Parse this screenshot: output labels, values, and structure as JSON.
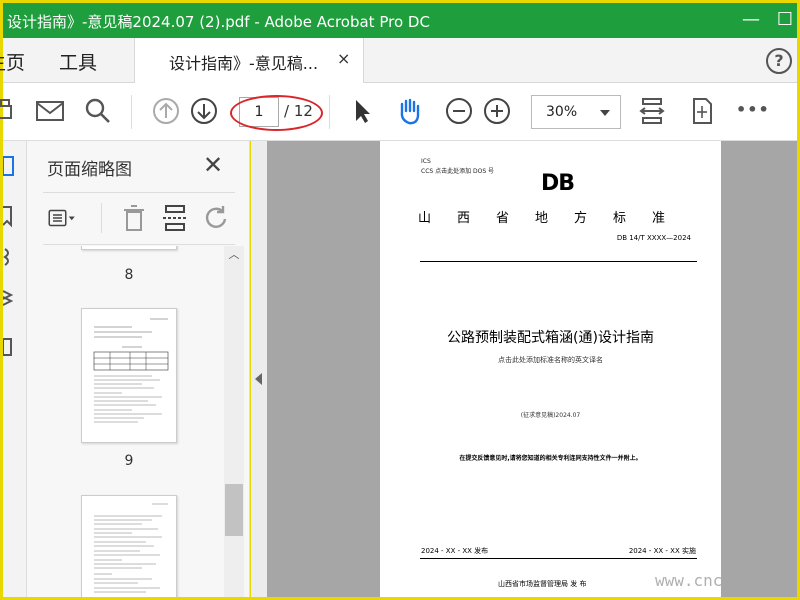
{
  "window": {
    "title": "设计指南》-意见稿2024.07 (2).pdf - Adobe Acrobat Pro DC",
    "title_bar_color": "#1e9e3c",
    "minimize_glyph": "—",
    "maximize_glyph": "☐"
  },
  "menubar": {
    "home": "主页",
    "tools": "工具",
    "document_tab": "设计指南》-意见稿...",
    "tab_close": "×",
    "help": "?"
  },
  "toolbar": {
    "current_page": "1",
    "total_pages": "/ 12",
    "zoom": "30%",
    "more": "•••",
    "icons": [
      "print-icon",
      "mail-icon",
      "search-icon",
      "prev-page-icon",
      "next-page-icon",
      "select-cursor-icon",
      "hand-tool-icon",
      "zoom-out-icon",
      "zoom-in-icon",
      "scroll-mode-icon",
      "page-fit-icon",
      "more-tools-icon"
    ]
  },
  "panel": {
    "title": "页面缩略图",
    "close": "✕",
    "thumbnails": [
      {
        "number": "8"
      },
      {
        "number": "9"
      }
    ]
  },
  "document_page": {
    "ics": "ICS",
    "ccs": "CCS  点击此处添加 DOS 号",
    "db_logo": "DB",
    "province": "山西省地方标准",
    "code": "DB 14/T XXXX—2024",
    "title": "公路预制装配式箱涵(通)设计指南",
    "subtitle": "点击此处添加标准名称的英文译名",
    "draft": "(征求意见稿)2024.07",
    "note": "在提交反馈意见时,请将您知道的相关专利连同支持性文件一并附上。",
    "issue_date": "2024 - XX - XX 发布",
    "implement_date": "2024 - XX - XX 实施",
    "issuer": "山西省市场监督管理局    发 布"
  },
  "watermark": "www.cnc",
  "annotation_color": "#d9262b"
}
